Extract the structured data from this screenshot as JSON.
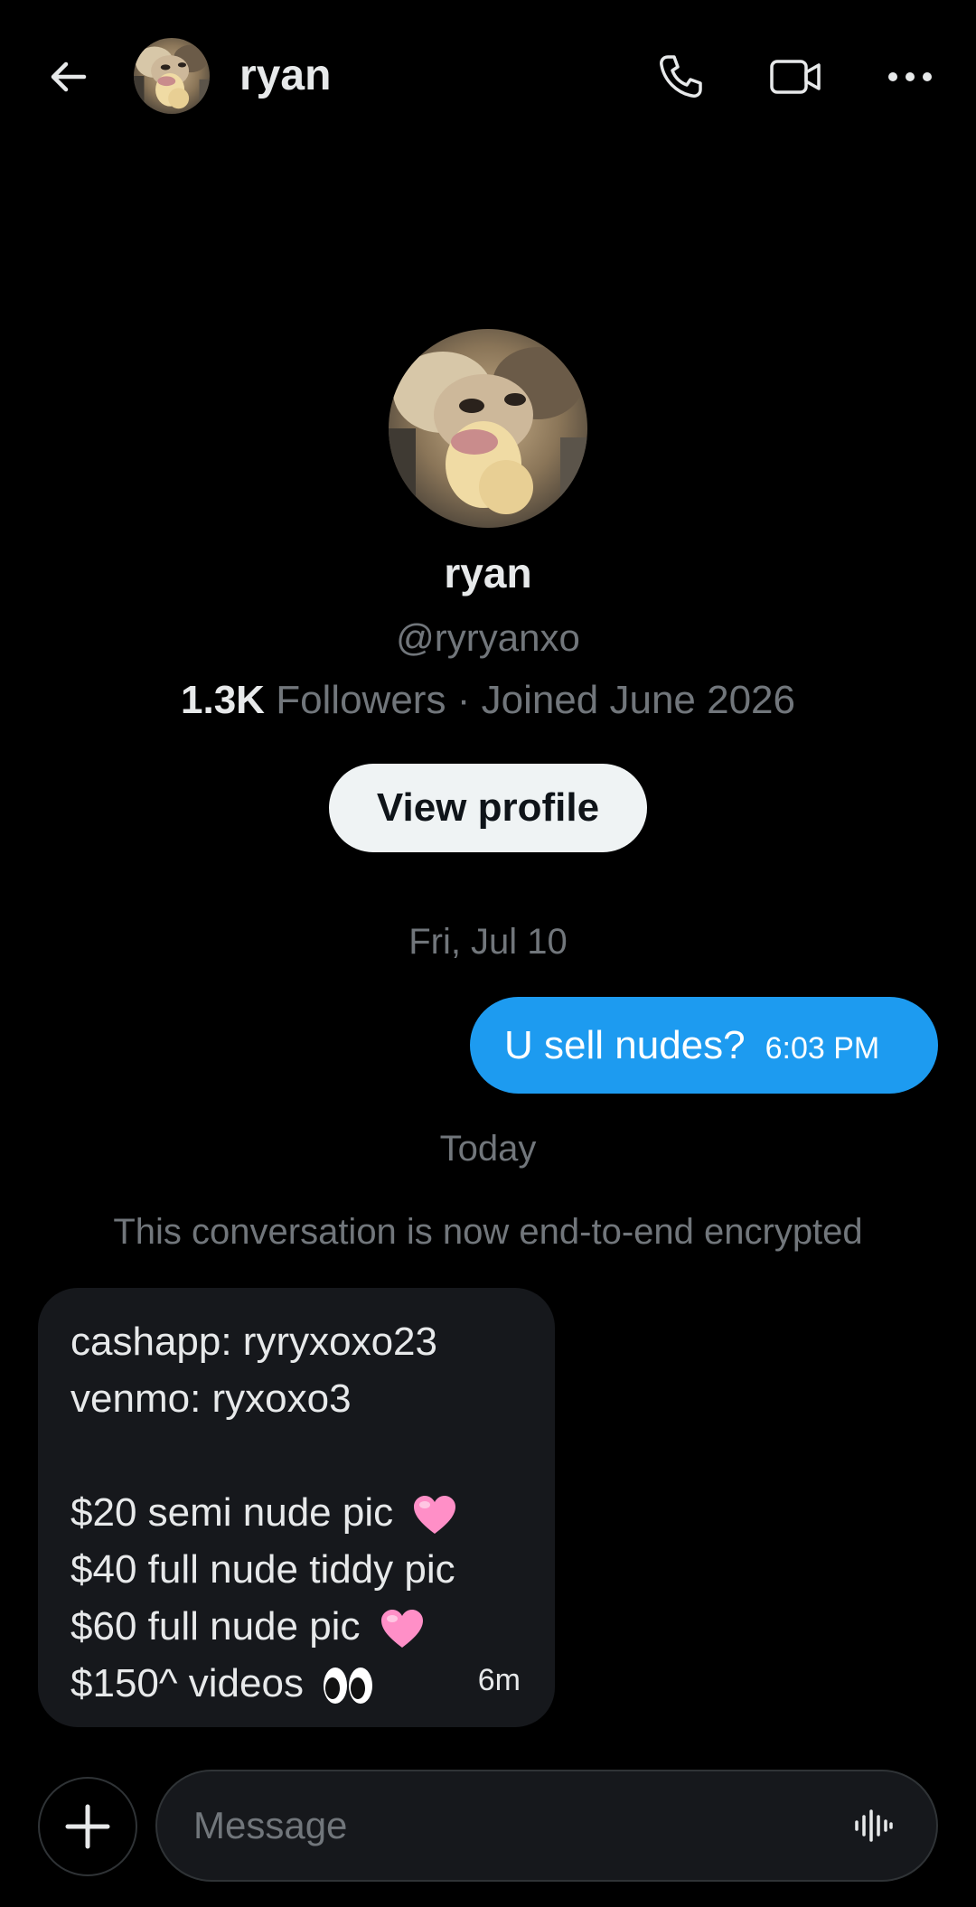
{
  "header": {
    "name": "ryan",
    "icons": {
      "back": "back-arrow-icon",
      "call": "phone-icon",
      "video": "video-camera-icon",
      "more": "more-icon"
    }
  },
  "profile": {
    "name": "ryan",
    "handle": "@ryryanxo",
    "followers_count": "1.3K",
    "followers_label": "Followers",
    "separator": "·",
    "joined": "Joined June 2026",
    "view_profile_label": "View profile"
  },
  "conversation": {
    "date_1": "Fri, Jul 10",
    "outgoing": {
      "text": "U sell nudes?",
      "time": "6:03 PM"
    },
    "date_2": "Today",
    "encryption_note": "This conversation is now end-to-end encrypted",
    "incoming": {
      "lines": [
        "cashapp: ryryxoxo23",
        "venmo: ryxoxo3",
        "",
        "$20 semi nude pic",
        "$40 full nude tiddy pic",
        "$60 full nude pic",
        "$150^ videos"
      ],
      "time": "6m"
    }
  },
  "composer": {
    "placeholder": "Message",
    "icons": {
      "add": "plus-icon",
      "voice": "voice-waveform-icon"
    }
  },
  "colors": {
    "background": "#000000",
    "accent": "#1d9bf0",
    "bubble_incoming": "#16181c",
    "muted_text": "#71767b",
    "heart": "#ff8fc7"
  }
}
